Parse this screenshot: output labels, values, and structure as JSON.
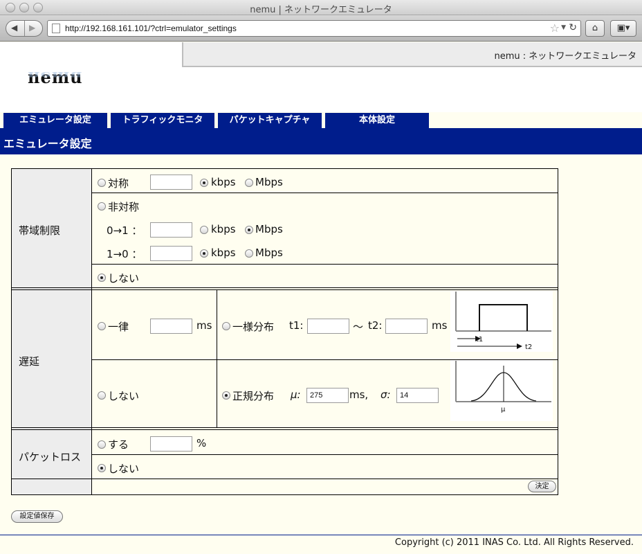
{
  "window": {
    "title": "nemu | ネットワークエミュレータ"
  },
  "browser": {
    "url": "http://192.168.161.101/?ctrl=emulator_settings",
    "star_glyph": "☆",
    "dropdown_glyph": "▼",
    "reload_glyph": "↻",
    "home_glyph": "⌂",
    "bookmark_glyph": "▣▾",
    "back_glyph": "◀",
    "forward_glyph": "▶"
  },
  "header": {
    "subtitle": "nemu : ネットワークエミュレータ",
    "logo": "nemu"
  },
  "tabs": [
    {
      "label": "エミュレータ設定"
    },
    {
      "label": "トラフィックモニタ"
    },
    {
      "label": "パケットキャプチャ"
    },
    {
      "label": "本体設定"
    }
  ],
  "section_title": "エミュレータ設定",
  "bandwidth": {
    "label": "帯域制限",
    "symmetric": {
      "label": "対称",
      "value": "",
      "kbps": "kbps",
      "mbps": "Mbps",
      "selected_unit": "kbps"
    },
    "asymmetric": {
      "label": "非対称",
      "dir01": {
        "label": "0→1 ：",
        "value": "",
        "kbps": "kbps",
        "mbps": "Mbps",
        "selected_unit": "Mbps"
      },
      "dir10": {
        "label": "1→0 ：",
        "value": "",
        "kbps": "kbps",
        "mbps": "Mbps",
        "selected_unit": "kbps"
      }
    },
    "none": {
      "label": "しない"
    },
    "selected": "none"
  },
  "delay": {
    "label": "遅延",
    "constant": {
      "label": "一律",
      "value": "",
      "unit": "ms"
    },
    "uniform": {
      "label": "一様分布",
      "t1_label": "t1:",
      "t1_value": "",
      "tilde": "〜",
      "t2_label": "t2:",
      "t2_value": "",
      "unit": "ms",
      "graph": {
        "t1": "t1",
        "t2": "t2"
      }
    },
    "none": {
      "label": "しない"
    },
    "normal": {
      "label": "正規分布",
      "mu_label": "μ:",
      "mu_value": "275",
      "mu_unit": "ms,",
      "sigma_label": "σ:",
      "sigma_value": "14",
      "graph": {
        "mu": "μ"
      }
    },
    "selected": "normal"
  },
  "packet_loss": {
    "label": "パケットロス",
    "on": {
      "label": "する",
      "value": "",
      "unit": "%"
    },
    "none": {
      "label": "しない"
    },
    "selected": "none"
  },
  "apply_button": "決定",
  "save_button": "設定値保存",
  "footer": "Copyright (c) 2011 INAS Co. Ltd. All Rights Reserved."
}
